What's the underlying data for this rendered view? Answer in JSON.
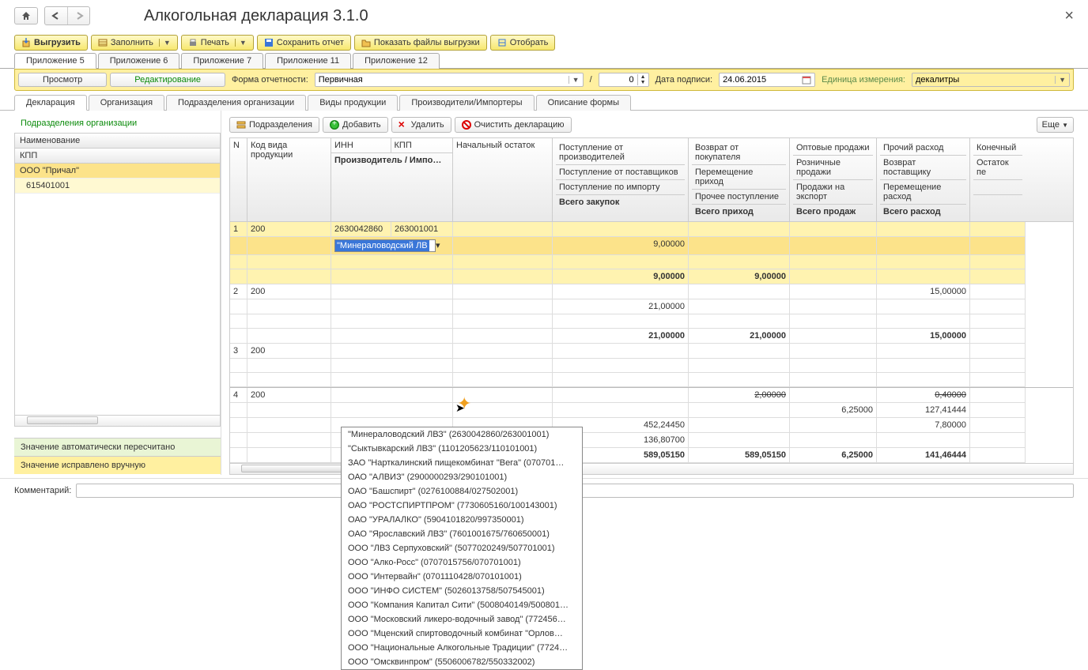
{
  "title": "Алкогольная декларация 3.1.0",
  "toolbar": {
    "export": "Выгрузить",
    "fill": "Заполнить",
    "print": "Печать",
    "save": "Сохранить отчет",
    "show": "Показать файлы выгрузки",
    "select": "Отобрать"
  },
  "tabs": [
    "Приложение 5",
    "Приложение 6",
    "Приложение 7",
    "Приложение 11",
    "Приложение 12"
  ],
  "mode": {
    "view": "Просмотр",
    "edit": "Редактирование"
  },
  "reportForm": {
    "label": "Форма отчетности:",
    "value": "Первичная"
  },
  "corr": "0",
  "signDate": {
    "label": "Дата подписи:",
    "value": "24.06.2015"
  },
  "unit": {
    "label": "Единица измерения:",
    "value": "декалитры"
  },
  "subtabs": [
    "Декларация",
    "Организация",
    "Подразделения организации",
    "Виды продукции",
    "Производители/Импортеры",
    "Описание формы"
  ],
  "left": {
    "title": "Подразделения организации",
    "hdrs": [
      "Наименование",
      "КПП"
    ],
    "rows": [
      "ООО \"Причал\"",
      "615401001"
    ]
  },
  "legend": {
    "auto": "Значение автоматически пересчитано",
    "manual": "Значение исправлено вручную"
  },
  "rp": {
    "sub": "Подразделения",
    "add": "Добавить",
    "del": "Удалить",
    "clear": "Очистить декларацию",
    "more": "Еще"
  },
  "cols": {
    "n": "N",
    "kod": "Код вида продукции",
    "inn": "ИНН",
    "kpp": "КПП",
    "prod": "Производитель / Импо…",
    "nach": "Начальный остаток",
    "g1": [
      "Поступление от производителей",
      "Поступление от поставщиков",
      "Поступление по импорту",
      "Всего закупок"
    ],
    "g2": [
      "Возврат от покупателя",
      "Перемещение приход",
      "Прочее поступление",
      "Всего приход"
    ],
    "g3": [
      "Оптовые продажи",
      "Розничные продажи",
      "Продажи на экспорт",
      "Всего продаж"
    ],
    "g4": [
      "Прочий расход",
      "Возврат поставщику",
      "Перемещение расход",
      "Всего расход"
    ],
    "end": "Конечный",
    "end2": "Остаток пе"
  },
  "data_rows": [
    {
      "n": "1",
      "kod": "200",
      "inn": "2630042860",
      "kpp": "263001001",
      "edit": "\"Минераловодский ЛВ",
      "v1": "9,00000",
      "t1": "9,00000",
      "t2": "9,00000"
    },
    {
      "n": "2",
      "kod": "200",
      "v1": "21,00000",
      "v4": "15,00000",
      "t1": "21,00000",
      "t2": "21,00000",
      "t4": "15,00000"
    },
    {
      "n": "3",
      "kod": "200"
    },
    {
      "n": "4",
      "kod": "200",
      "a": "2,00000",
      "b": "0,40000",
      "c": "6,25000",
      "d": "127,41444",
      "e": "452,24450",
      "f": "7,80000",
      "g": "136,80700",
      "h": "589,05150",
      "i": "589,05150",
      "j": "6,25000",
      "k": "141,46444"
    }
  ],
  "dd_options": [
    "\"Минераловодский ЛВЗ\" (2630042860/263001001)",
    "\"Сыктывкарский ЛВЗ\" (1101205623/110101001)",
    "ЗАО \"Нарткалинский пищекомбинат \"Вега\" (070701…",
    "ОАО \"АЛВИЗ\" (2900000293/290101001)",
    "ОАО \"Башспирт\" (0276100884/027502001)",
    "ОАО \"РОСТСПИРТПРОМ\" (7730605160/100143001)",
    "ОАО \"УРАЛАЛКО\" (5904101820/997350001)",
    "ОАО \"Ярославский ЛВЗ\" (7601001675/760650001)",
    "ООО  \"ЛВЗ Серпуховский\" (5077020249/507701001)",
    "ООО \"Алко-Росс\" (0707015756/070701001)",
    "ООО \"Интервайн\" (0701110428/070101001)",
    "ООО \"ИНФО СИСТЕМ\" (5026013758/507545001)",
    "ООО \"Компания Капитал Сити\" (5008040149/500801…",
    "ООО \"Московский ликеро-водочный завод\" (772456…",
    "ООО \"Мценский спиртоводочный комбинат \"Орлов…",
    "ООО \"Национальные Алкогольные Традиции\" (7724…",
    "ООО \"Омсквинпром\" (5506006782/550332002)"
  ],
  "comment": "Комментарий:"
}
